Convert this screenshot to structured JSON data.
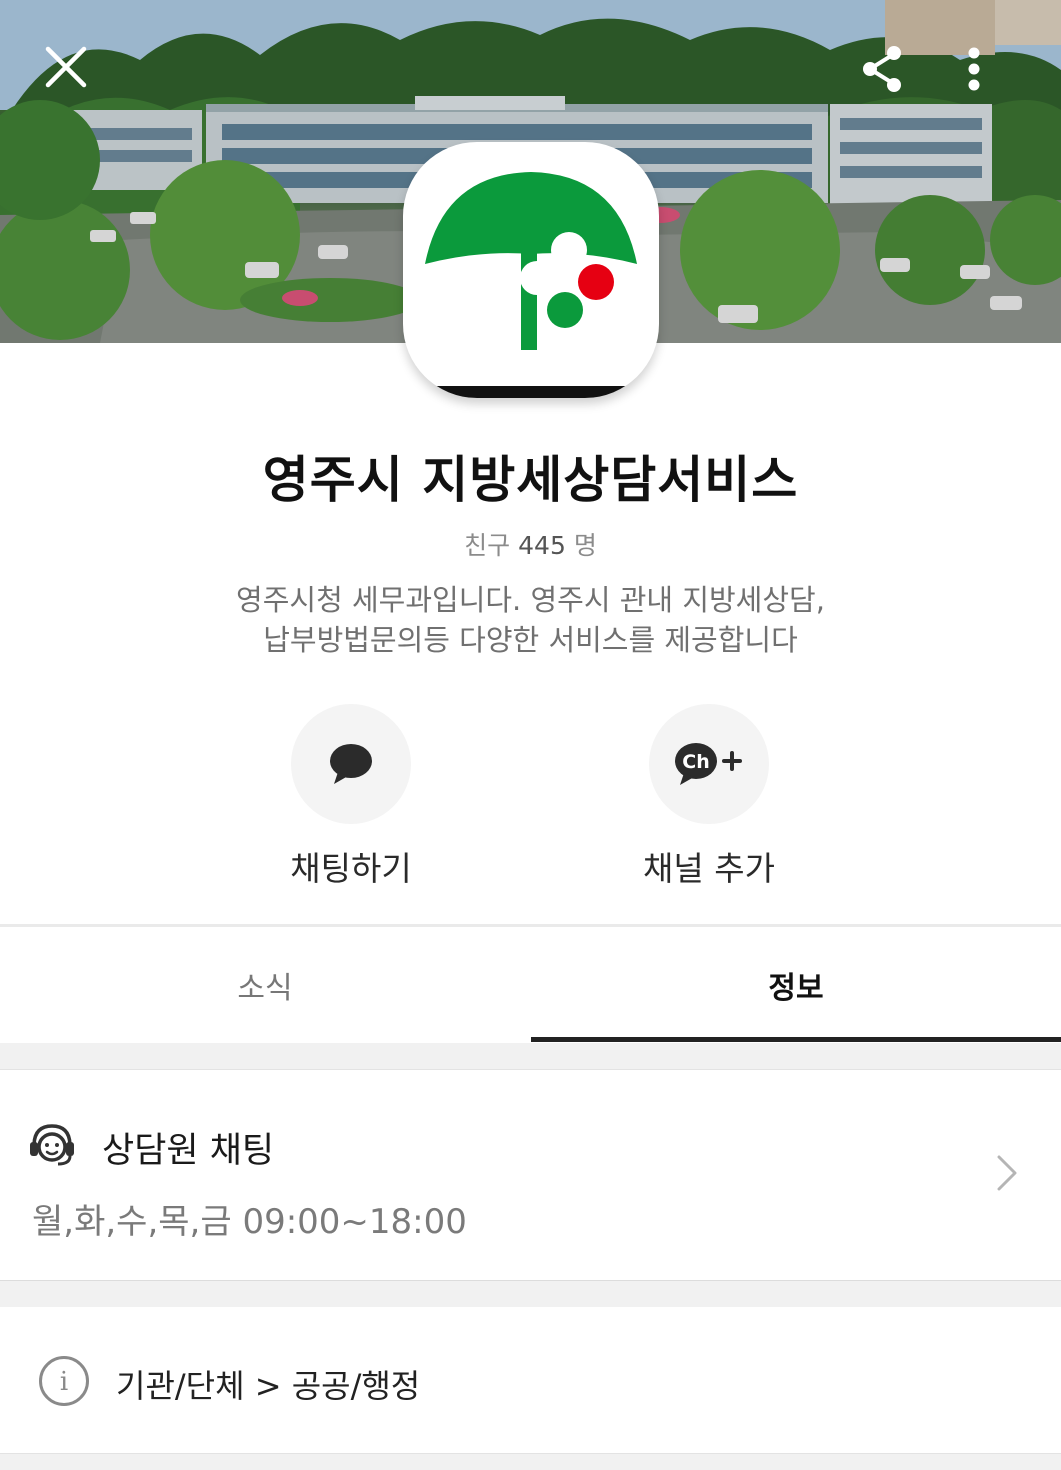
{
  "header": {
    "close_icon": "close-icon",
    "share_icon": "share-icon",
    "more_icon": "more-vertical-icon"
  },
  "profile": {
    "title": "영주시 지방세상담서비스",
    "friends_label": "친구",
    "friends_count": "445",
    "friends_unit": "명",
    "description_line1": "영주시청 세무과입니다. 영주시 관내 지방세상담,",
    "description_line2": "납부방법문의등 다양한 서비스를 제공합니다",
    "logo_colors": {
      "green": "#0b9a3c",
      "red": "#e60012"
    }
  },
  "actions": {
    "chat_label": "채팅하기",
    "chat_icon": "chat-bubble-icon",
    "add_label": "채널 추가",
    "add_icon": "channel-add-icon",
    "add_icon_text": "Ch"
  },
  "tabs": [
    {
      "label": "소식",
      "active": false
    },
    {
      "label": "정보",
      "active": true
    }
  ],
  "counselor": {
    "icon": "headset-agent-icon",
    "title": "상담원 채팅",
    "hours": "월,화,수,목,금 09:00~18:00"
  },
  "category": {
    "icon": "info-icon",
    "icon_text": "i",
    "text": "기관/단체 > 공공/행정"
  }
}
